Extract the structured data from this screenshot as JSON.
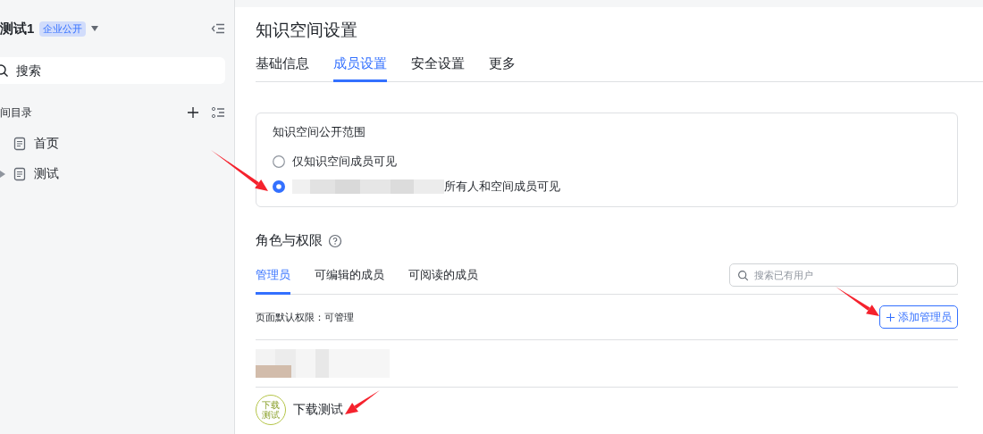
{
  "sidebar": {
    "space_name": "测试1",
    "badge": "企业公开",
    "search": {
      "placeholder": "搜索"
    },
    "directory_label": "间目录",
    "items": [
      {
        "label": "首页",
        "expandable": false
      },
      {
        "label": "测试",
        "expandable": true
      }
    ]
  },
  "main": {
    "title": "知识空间设置",
    "tabs": [
      {
        "label": "基础信息",
        "selected": false
      },
      {
        "label": "成员设置",
        "selected": true
      },
      {
        "label": "安全设置",
        "selected": false
      },
      {
        "label": "更多",
        "selected": false
      }
    ],
    "visibility": {
      "title": "知识空间公开范围",
      "options": [
        {
          "label": "仅知识空间成员可见",
          "selected": false,
          "redacted": false
        },
        {
          "label": "所有人和空间成员可见",
          "selected": true,
          "redacted": true
        }
      ]
    },
    "roles": {
      "title": "角色与权限",
      "tabs": [
        {
          "label": "管理员",
          "selected": true
        },
        {
          "label": "可编辑的成员",
          "selected": false
        },
        {
          "label": "可阅读的成员",
          "selected": false
        }
      ],
      "search": {
        "placeholder": "搜索已有用户"
      },
      "default_permission": "页面默认权限：可管理",
      "add_button": "添加管理员",
      "members": [
        {
          "redacted": true
        },
        {
          "redacted": false,
          "avatar_text": [
            "下载",
            "测试"
          ],
          "name": "下载测试"
        }
      ]
    }
  }
}
